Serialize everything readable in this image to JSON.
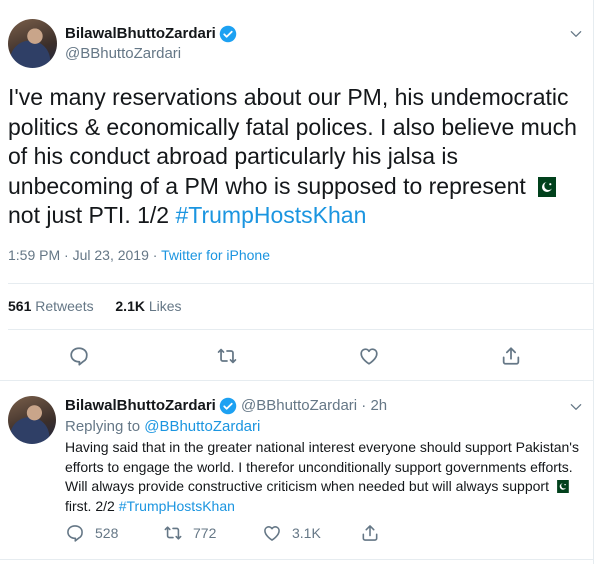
{
  "tweet": {
    "display_name": "BilawalBhuttoZardari",
    "handle": "@BBhuttoZardari",
    "text_main": "I've many reservations about our PM, his undemocratic politics & economically fatal polices. I also believe much of his conduct abroad particularly his jalsa is unbecoming of a PM who is supposed to represent ",
    "text_after_flag": " not just PTI. 1/2 ",
    "hashtag": "#TrumpHostsKhan",
    "timestamp": "1:59 PM · Jul 23, 2019 · ",
    "source": "Twitter for iPhone",
    "retweets_count": "561",
    "retweets_label": "Retweets",
    "likes_count": "2.1K",
    "likes_label": "Likes"
  },
  "reply": {
    "display_name": "BilawalBhuttoZardari",
    "handle_time": "@BBhuttoZardari · 2h",
    "replying_prefix": "Replying to ",
    "replying_to": "@BBhuttoZardari",
    "text_main": "Having said that in the greater national interest everyone should support Pakistan's efforts to engage the world. I therefor unconditionally support governments efforts. Will always provide constructive criticism when needed but will always support ",
    "text_after_flag": " first. 2/2 ",
    "hashtag": "#TrumpHostsKhan",
    "reply_count": "528",
    "retweet_count": "772",
    "like_count": "3.1K"
  },
  "colors": {
    "link": "#1b95e0",
    "verified": "#1da1f2",
    "secondary_text": "#657786",
    "divider": "#e6ecf0",
    "flag_green": "#01411c"
  },
  "icons": [
    "verified-badge-icon",
    "chevron-down-icon",
    "reply-icon",
    "retweet-icon",
    "like-icon",
    "share-icon",
    "pakistan-flag-icon"
  ]
}
